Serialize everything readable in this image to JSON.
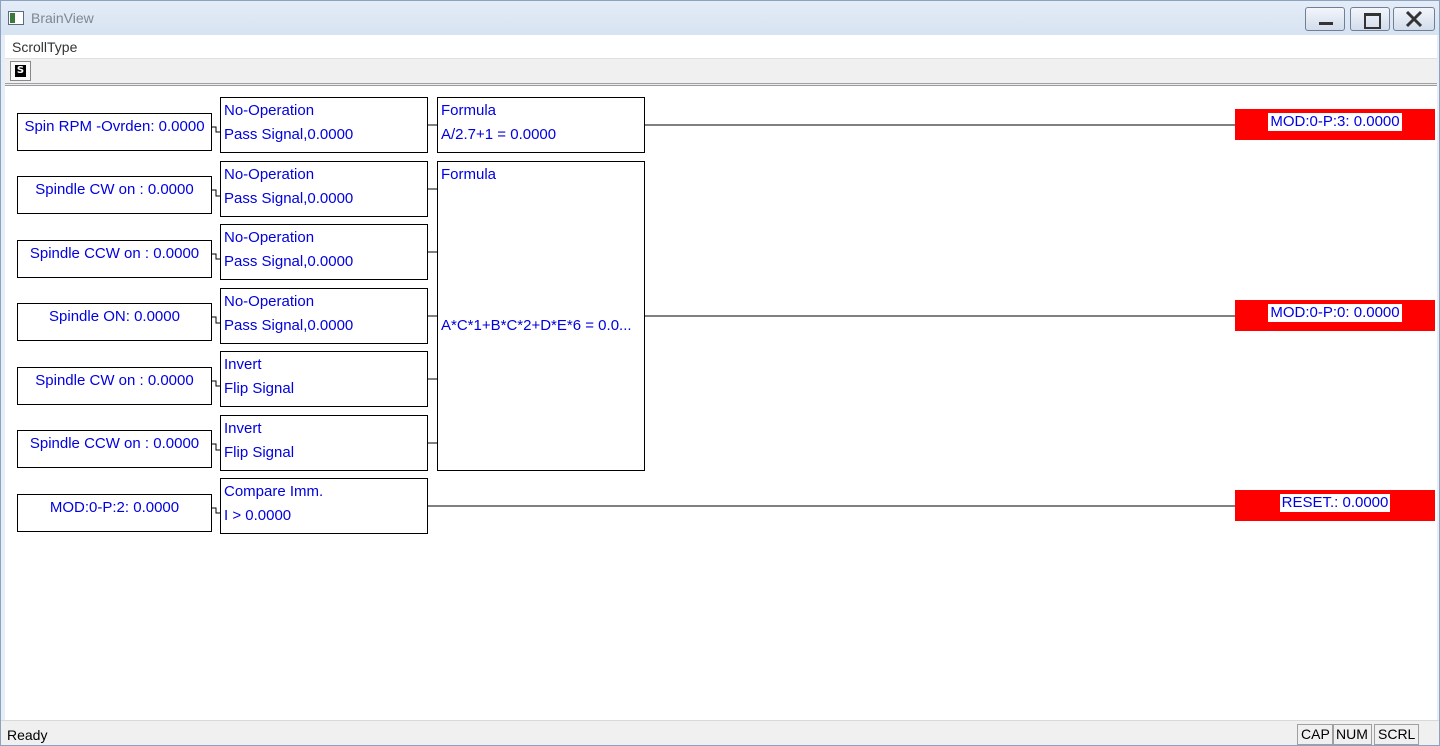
{
  "window": {
    "title": "BrainView"
  },
  "menu": {
    "items": [
      "ScrollType"
    ]
  },
  "toolbar": {
    "s_button_label": "S"
  },
  "diagram": {
    "sources": [
      "Spin RPM -Ovrden: 0.0000",
      "Spindle CW on : 0.0000",
      "Spindle CCW on : 0.0000",
      "Spindle ON: 0.0000",
      "Spindle CW on : 0.0000",
      "Spindle CCW on : 0.0000",
      "MOD:0-P:2: 0.0000"
    ],
    "operations": [
      {
        "name": "No-Operation",
        "detail": "Pass Signal,0.0000"
      },
      {
        "name": "No-Operation",
        "detail": "Pass Signal,0.0000"
      },
      {
        "name": "No-Operation",
        "detail": "Pass Signal,0.0000"
      },
      {
        "name": "No-Operation",
        "detail": "Pass Signal,0.0000"
      },
      {
        "name": "Invert",
        "detail": "Flip Signal"
      },
      {
        "name": "Invert",
        "detail": "Flip Signal"
      },
      {
        "name": "Compare Imm.",
        "detail": "I > 0.0000"
      }
    ],
    "formulas": [
      {
        "name": "Formula",
        "expression": "A/2.7+1 = 0.0000"
      },
      {
        "name": "Formula",
        "expression": "A*C*1+B*C*2+D*E*6 = 0.0..."
      }
    ],
    "outputs": [
      "MOD:0-P:3: 0.0000",
      "MOD:0-P:0: 0.0000",
      "RESET.: 0.0000"
    ],
    "output_color": "#ff0000",
    "text_color": "#0000e0"
  },
  "status": {
    "text": "Ready",
    "indicators": [
      "CAP",
      "NUM",
      "SCRL"
    ]
  }
}
